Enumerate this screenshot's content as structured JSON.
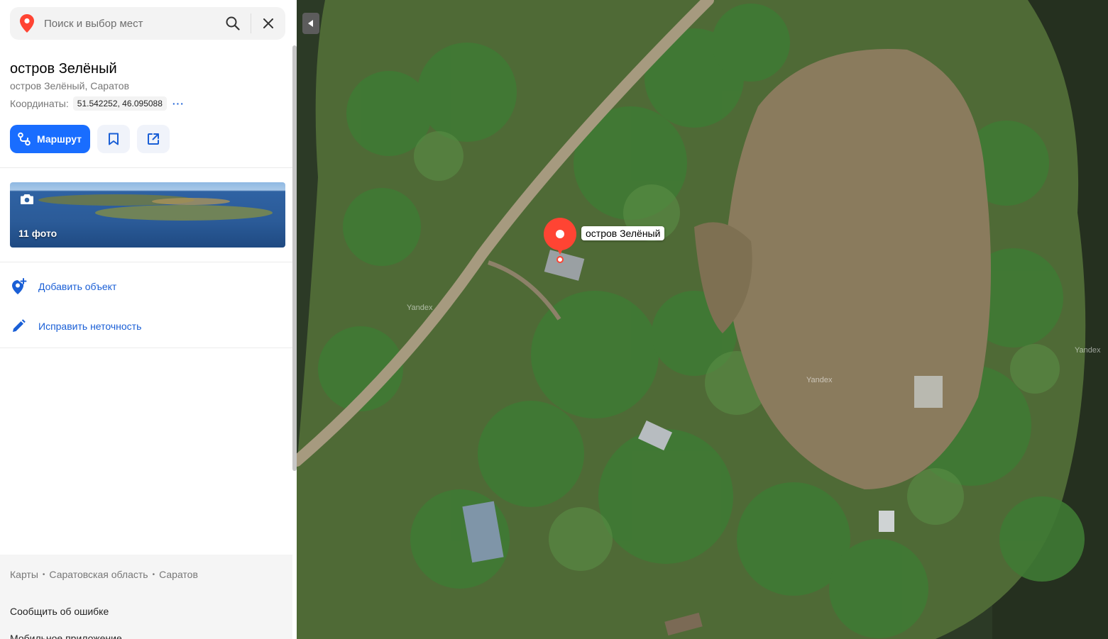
{
  "search": {
    "placeholder": "Поиск и выбор мест"
  },
  "place": {
    "title": "остров Зелёный",
    "subtitle": "остров Зелёный, Саратов",
    "coords_label": "Координаты:",
    "coords_value": "51.542252, 46.095088",
    "coords_more": "···"
  },
  "actions": {
    "route_label": "Маршрут"
  },
  "photos": {
    "count_label": "11 фото"
  },
  "links": {
    "add_object": "Добавить объект",
    "fix_error": "Исправить неточность"
  },
  "footer": {
    "breadcrumbs": [
      "Карты",
      "Саратовская область",
      "Саратов"
    ],
    "report": "Сообщить об ошибке",
    "mobile": "Мобильное приложение"
  },
  "map": {
    "marker_label": "остров Зелёный",
    "watermark": "Yandex",
    "collapse_icon": "triangle-left-icon"
  },
  "colors": {
    "accent": "#196dff",
    "link": "#1a5fd6",
    "marker": "#f43",
    "search_pin": "#f43"
  }
}
